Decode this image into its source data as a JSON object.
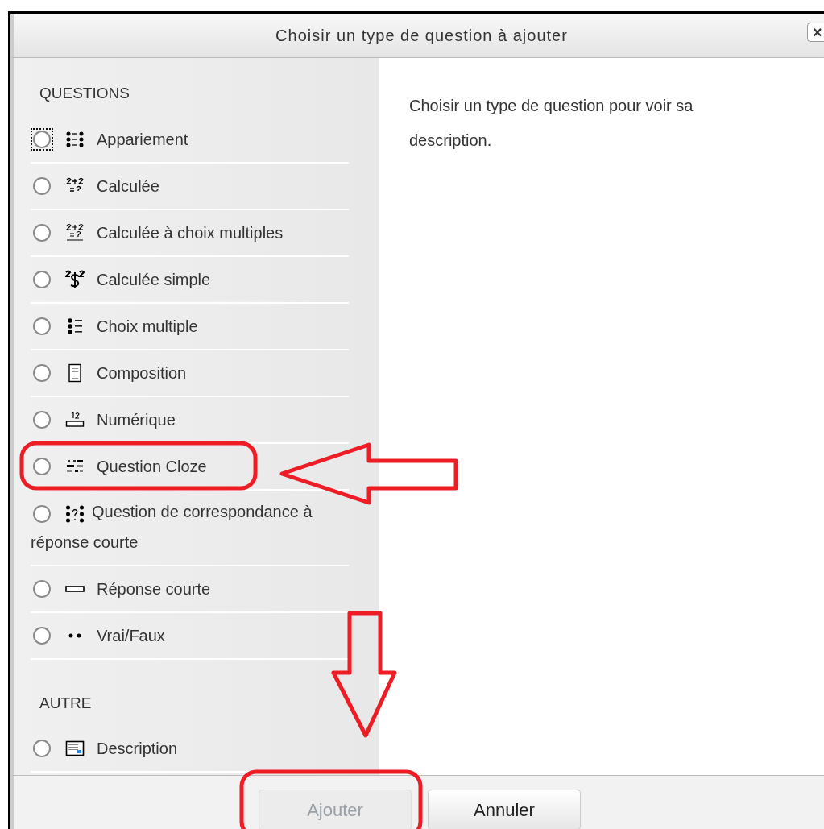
{
  "dialog": {
    "title": "Choisir un type de question à ajouter",
    "close": "×"
  },
  "sections": [
    {
      "heading": "QUESTIONS",
      "items": [
        {
          "label": "Appariement",
          "kind": "matching",
          "selected": false,
          "focused": true
        },
        {
          "label": "Calculée",
          "kind": "calculated",
          "selected": false,
          "focused": false
        },
        {
          "label": "Calculée à choix multiples",
          "kind": "calculated-multi",
          "selected": false,
          "focused": false
        },
        {
          "label": "Calculée simple",
          "kind": "calculated-simple",
          "selected": false,
          "focused": false
        },
        {
          "label": "Choix multiple",
          "kind": "multichoice",
          "selected": false,
          "focused": false
        },
        {
          "label": "Composition",
          "kind": "essay",
          "selected": false,
          "focused": false
        },
        {
          "label": "Numérique",
          "kind": "numerical",
          "selected": false,
          "focused": false
        },
        {
          "label": "Question Cloze",
          "kind": "cloze",
          "selected": false,
          "focused": false
        },
        {
          "label": "Question de correspondance à réponse courte",
          "kind": "random-match",
          "selected": false,
          "focused": false
        },
        {
          "label": "Réponse courte",
          "kind": "short-answer",
          "selected": false,
          "focused": false
        },
        {
          "label": "Vrai/Faux",
          "kind": "truefalse",
          "selected": false,
          "focused": false
        }
      ]
    },
    {
      "heading": "AUTRE",
      "items": [
        {
          "label": "Description",
          "kind": "description",
          "selected": false,
          "focused": false
        }
      ]
    }
  ],
  "description": "Choisir un type de question pour voir sa description.",
  "buttons": [
    {
      "label": "Ajouter",
      "disabled": true
    },
    {
      "label": "Annuler",
      "disabled": false
    }
  ]
}
